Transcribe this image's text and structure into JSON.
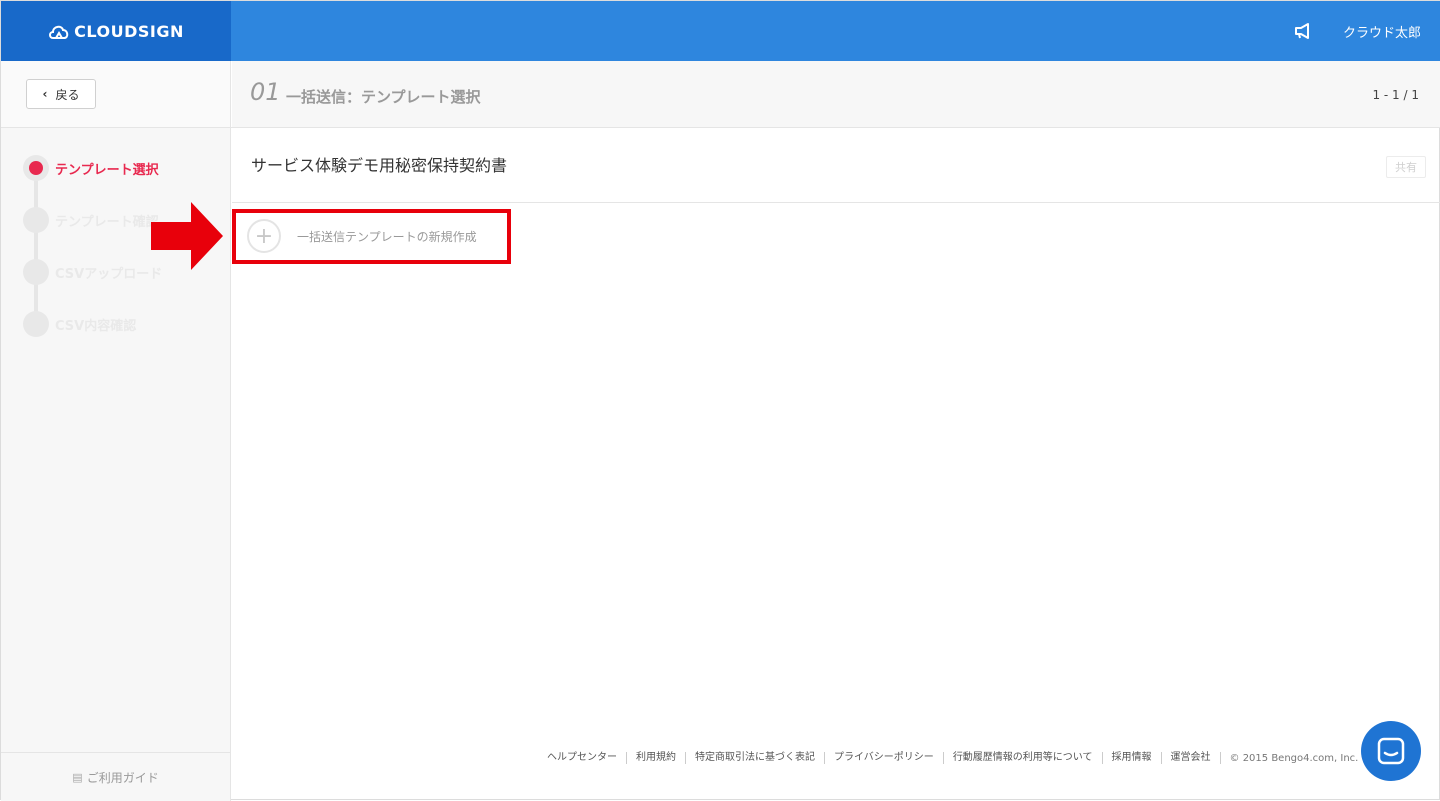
{
  "header": {
    "logo_text": "CLOUDSIGN",
    "user_name": "クラウド太郎",
    "brand_color": "#2e86de"
  },
  "subheader": {
    "back_label": "戻る",
    "step_number": "01",
    "step_title": "一括送信：テンプレート選択",
    "pager": "1 - 1 / 1"
  },
  "sidebar": {
    "steps": [
      {
        "label": "テンプレート選択",
        "active": true
      },
      {
        "label": "テンプレート確認",
        "active": false
      },
      {
        "label": "CSVアップロード",
        "active": false
      },
      {
        "label": "CSV内容確認",
        "active": false
      }
    ],
    "guide_label": "ご利用ガイド"
  },
  "content": {
    "template_name": "サービス体験デモ用秘密保持契約書",
    "share_badge": "共有",
    "new_template_label": "一括送信テンプレートの新規作成"
  },
  "footer": {
    "links": [
      "ヘルプセンター",
      "利用規約",
      "特定商取引法に基づく表記",
      "プライバシーポリシー",
      "行動履歴情報の利用等について",
      "採用情報",
      "運営会社"
    ],
    "copyright": "© 2015 Bengo4.com, Inc."
  }
}
